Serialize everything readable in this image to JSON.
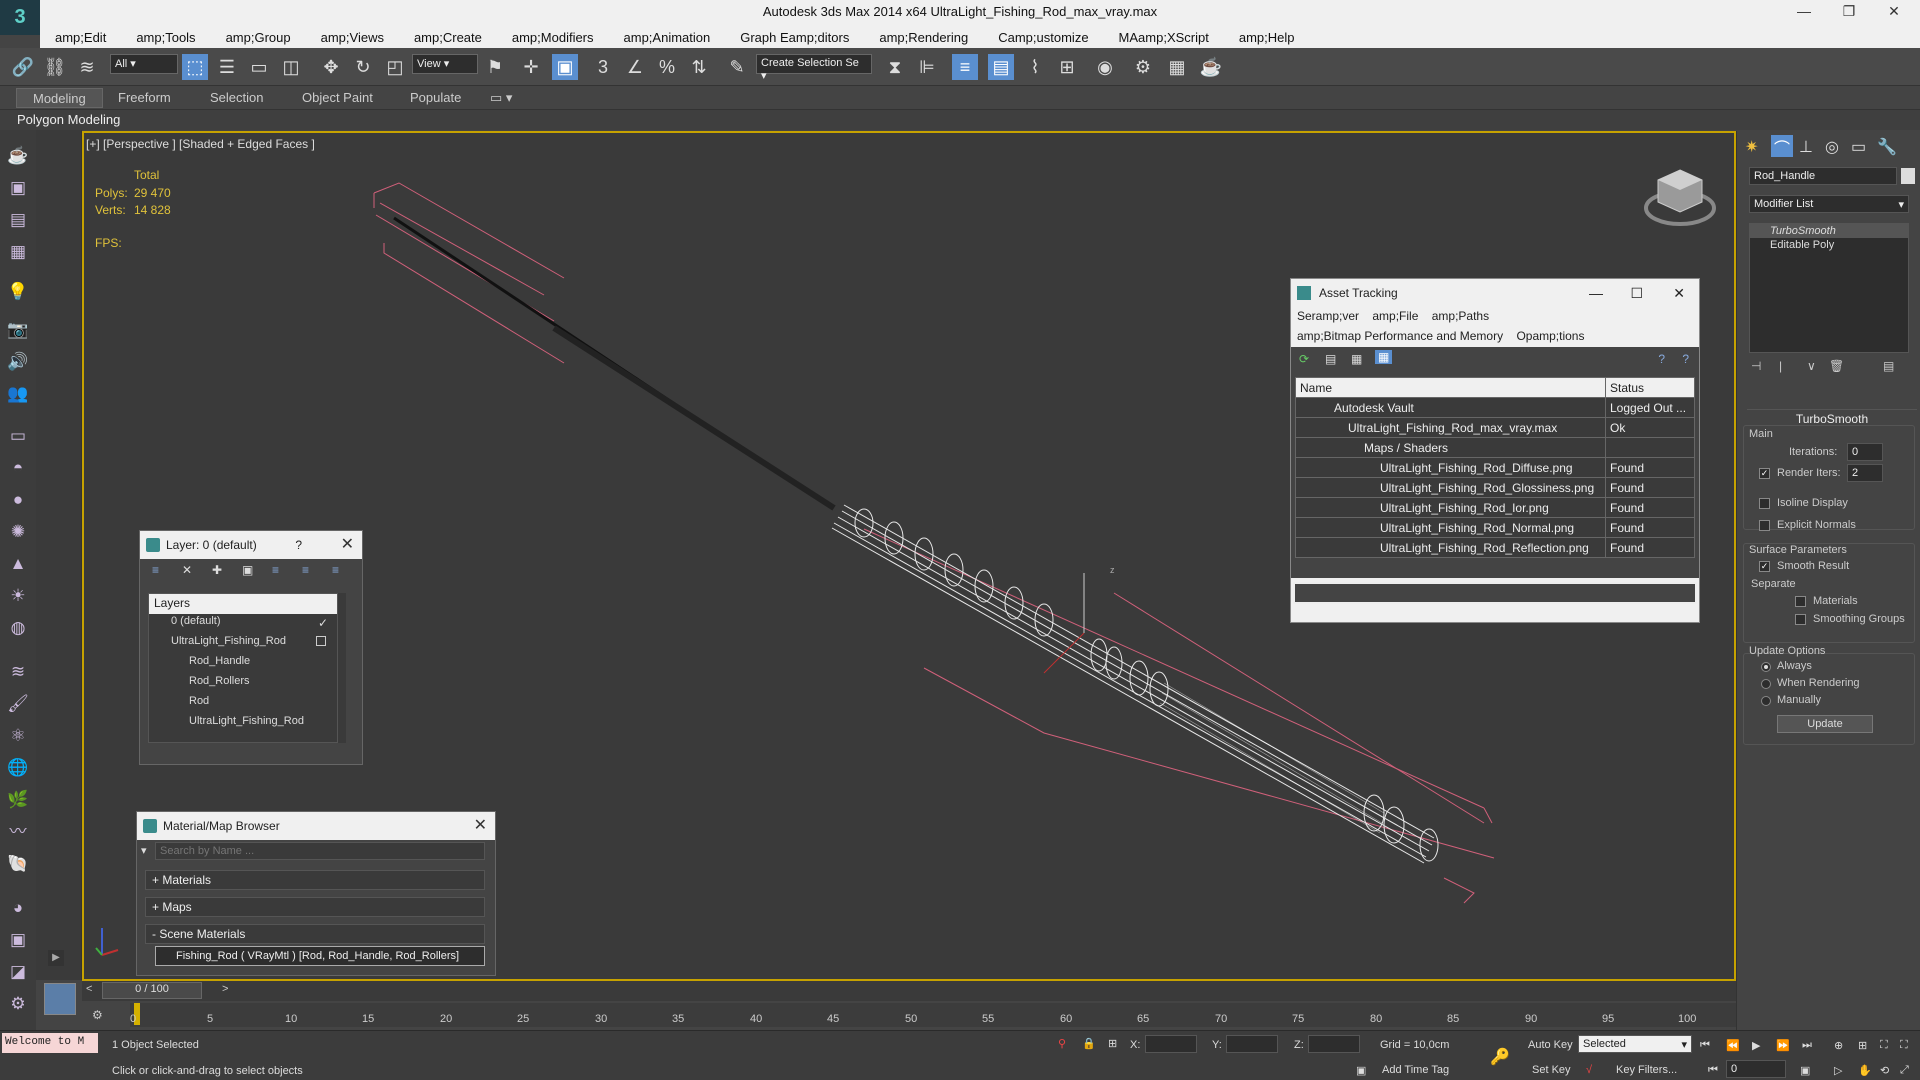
{
  "window": {
    "title": "Autodesk 3ds Max  2014 x64    UltraLight_Fishing_Rod_max_vray.max"
  },
  "menu": [
    "amp;Edit",
    "amp;Tools",
    "amp;Group",
    "amp;Views",
    "amp;Create",
    "amp;Modifiers",
    "amp;Animation",
    "Graph Eamp;ditors",
    "amp;Rendering",
    "Camp;ustomize",
    "MAamp;XScript",
    "amp;Help"
  ],
  "toolbar": {
    "filter_select": "All",
    "view_select": "View",
    "selection_set": "Create Selection Se"
  },
  "ribbon": {
    "tabs": [
      "Modeling",
      "Freeform",
      "Selection",
      "Object Paint",
      "Populate"
    ],
    "active": "Modeling",
    "sub_label": "Polygon Modeling"
  },
  "viewport": {
    "label": "[+] [Perspective ] [Shaded + Edged Faces ]",
    "stats": {
      "total_label": "Total",
      "polys_label": "Polys:",
      "polys_value": "29 470",
      "verts_label": "Verts:",
      "verts_value": "14 828",
      "fps_label": "FPS:"
    }
  },
  "right_panel": {
    "object_name": "Rod_Handle",
    "modifier_list": "Modifier List",
    "stack": [
      "TurboSmooth",
      "Editable Poly"
    ],
    "rollout_title": "TurboSmooth",
    "main_label": "Main",
    "iterations_label": "Iterations:",
    "iterations_value": "0",
    "render_iters_label": "Render Iters:",
    "render_iters_value": "2",
    "isoline_label": "Isoline Display",
    "explicit_label": "Explicit Normals",
    "surface_params_label": "Surface Parameters",
    "smooth_result_label": "Smooth Result",
    "separate_label": "Separate",
    "materials_label": "Materials",
    "smoothing_groups_label": "Smoothing Groups",
    "update_options_label": "Update Options",
    "always_label": "Always",
    "when_rendering_label": "When Rendering",
    "manually_label": "Manually",
    "update_button": "Update"
  },
  "layer_dialog": {
    "title": "Layer: 0 (default)",
    "help": "?",
    "header": "Layers",
    "items": [
      {
        "label": "0 (default)",
        "indent": 1
      },
      {
        "label": "UltraLight_Fishing_Rod",
        "indent": 1
      },
      {
        "label": "Rod_Handle",
        "indent": 2
      },
      {
        "label": "Rod_Rollers",
        "indent": 2
      },
      {
        "label": "Rod",
        "indent": 2
      },
      {
        "label": "UltraLight_Fishing_Rod",
        "indent": 2
      }
    ]
  },
  "asset_tracking": {
    "title": "Asset Tracking",
    "menu_row1": [
      "Seramp;ver",
      "amp;File",
      "amp;Paths"
    ],
    "menu_row2": [
      "amp;Bitmap Performance and Memory",
      "Opamp;tions"
    ],
    "col_name": "Name",
    "col_status": "Status",
    "rows": [
      {
        "name": "Autodesk Vault",
        "status": "Logged Out ...",
        "indent": 1
      },
      {
        "name": "UltraLight_Fishing_Rod_max_vray.max",
        "status": "Ok",
        "indent": 2
      },
      {
        "name": "Maps / Shaders",
        "status": "",
        "indent": 3
      },
      {
        "name": "UltraLight_Fishing_Rod_Diffuse.png",
        "status": "Found",
        "indent": 4
      },
      {
        "name": "UltraLight_Fishing_Rod_Glossiness.png",
        "status": "Found",
        "indent": 4
      },
      {
        "name": "UltraLight_Fishing_Rod_Ior.png",
        "status": "Found",
        "indent": 4
      },
      {
        "name": "UltraLight_Fishing_Rod_Normal.png",
        "status": "Found",
        "indent": 4
      },
      {
        "name": "UltraLight_Fishing_Rod_Reflection.png",
        "status": "Found",
        "indent": 4
      }
    ]
  },
  "material_browser": {
    "title": "Material/Map Browser",
    "search_placeholder": "Search by Name ...",
    "sections": [
      "+ Materials",
      "+ Maps",
      "- Scene Materials"
    ],
    "scene_material": "Fishing_Rod ( VRayMtl ) [Rod, Rod_Handle, Rod_Rollers]"
  },
  "timeline": {
    "position": "0 / 100",
    "ticks": [
      "0",
      "5",
      "10",
      "15",
      "20",
      "25",
      "30",
      "35",
      "40",
      "45",
      "50",
      "55",
      "60",
      "65",
      "70",
      "75",
      "80",
      "85",
      "90",
      "95",
      "100"
    ]
  },
  "status": {
    "welcome": "Welcome to M",
    "selected": "1 Object Selected",
    "prompt": "Click or click-and-drag to select objects",
    "x_label": "X:",
    "y_label": "Y:",
    "z_label": "Z:",
    "grid": "Grid = 10,0cm",
    "add_time_tag": "Add Time Tag",
    "auto_key": "Auto Key",
    "set_key": "Set Key",
    "selected_dropdown": "Selected",
    "key_filters": "Key Filters...",
    "frame": "0"
  },
  "colors": {
    "accent": "#5a8fd0",
    "viewport_border": "#c6a200",
    "stats": "#e0c23a",
    "bbox": "#d0607a"
  }
}
